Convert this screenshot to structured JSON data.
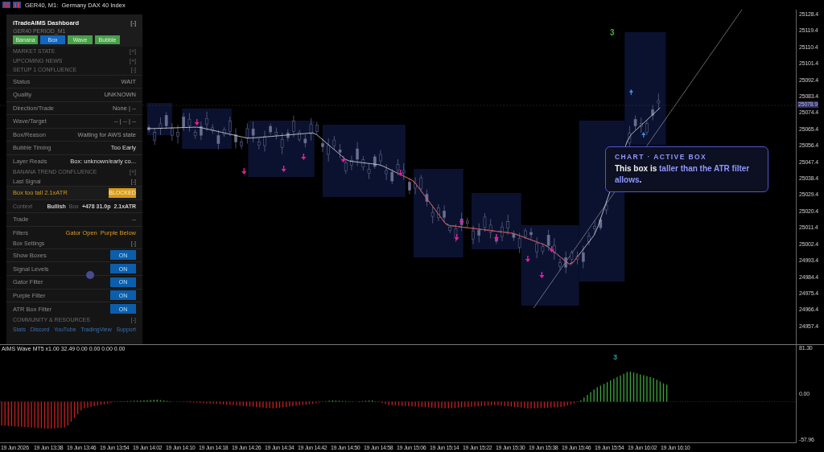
{
  "title_bar": {
    "text": "GER40, M1:  Germany DAX 40 Index"
  },
  "dashboard": {
    "title": "iTradeAIMS Dashboard",
    "collapse": "[-]",
    "subtitle": "GER40 PERIOD_M1",
    "mode_buttons": [
      {
        "label": "Banana",
        "selected": false
      },
      {
        "label": "Box",
        "selected": true
      },
      {
        "label": "Wave",
        "selected": false
      },
      {
        "label": "Bubble",
        "selected": false
      }
    ],
    "items": [
      {
        "kind": "section",
        "title": "MARKET STATE",
        "toggle": "[+]"
      },
      {
        "kind": "section",
        "title": "UPCOMING NEWS",
        "toggle": "[+]"
      },
      {
        "kind": "section",
        "title": "SETUP 1 CONFLUENCE",
        "toggle": "[-]"
      },
      {
        "kind": "row",
        "label": "Status",
        "value": "WAIT",
        "bright": false
      },
      {
        "kind": "row",
        "label": "Quality",
        "value": "UNKNOWN",
        "bright": false
      },
      {
        "kind": "row",
        "label": "Direction/Trade",
        "value": "None | --",
        "bright": false
      },
      {
        "kind": "row",
        "label": "Wave/Target",
        "value": "-- | -- | --",
        "bright": false
      },
      {
        "kind": "row",
        "label": "Box/Reason",
        "value": "Waiting for AWS state",
        "bright": false
      },
      {
        "kind": "row",
        "label": "Bubble Timing",
        "value": "Too Early",
        "bright": true
      },
      {
        "kind": "row",
        "label": "Layer Reads",
        "value": "Box: unknown/early co...",
        "bright": true
      },
      {
        "kind": "section",
        "title": "BANANA TREND CONFLUENCE",
        "toggle": "[+]"
      },
      {
        "kind": "subsection",
        "title": "Last Signal",
        "toggle": "[-]"
      },
      {
        "kind": "alert",
        "text": "Box too tall 2.1xATR",
        "button": "BLOCKED"
      },
      {
        "kind": "context",
        "label": "Context",
        "bias": "Bullish",
        "box": "Box",
        "size": "+478 31.0p",
        "atr": "2.1xATR"
      },
      {
        "kind": "row",
        "label": "Trade",
        "value": "--",
        "bright": false
      },
      {
        "kind": "filters",
        "label": "Filters",
        "values": [
          "Gator Open",
          "Purple Below"
        ]
      },
      {
        "kind": "subsection",
        "title": "Box Settings",
        "toggle": "[-]"
      },
      {
        "kind": "switch",
        "label": "Show Boxes",
        "state": "ON",
        "on": true
      },
      {
        "kind": "switch",
        "label": "Signal Levels",
        "state": "ON",
        "on": true
      },
      {
        "kind": "switch",
        "label": "Gator Filter",
        "state": "ON",
        "on": true
      },
      {
        "kind": "switch",
        "label": "Purple Filter",
        "state": "ON",
        "on": true
      },
      {
        "kind": "switch",
        "label": "ATR Box Filter",
        "state": "ON",
        "on": true
      },
      {
        "kind": "section",
        "title": "COMMUNITY & RESOURCES",
        "toggle": "[-]"
      },
      {
        "kind": "links",
        "links": [
          "Stats",
          "Discord",
          "YouTube",
          "TradingView",
          "Support"
        ]
      }
    ]
  },
  "chart": {
    "wave_label": "3",
    "price_axis": [
      "25128.4",
      "25119.4",
      "25110.4",
      "25101.4",
      "25092.4",
      "25083.4",
      "25074.4",
      "25065.4",
      "25056.4",
      "25047.4",
      "25038.4",
      "25029.4",
      "25020.4",
      "25011.4",
      "25002.4",
      "24993.4",
      "24984.4",
      "24975.4",
      "24966.4",
      "24957.4"
    ],
    "current_price": "25078.9"
  },
  "callout": {
    "title": "CHART · ACTIVE BOX",
    "body": "This box is **taller than the ATR filter allows**."
  },
  "indicator": {
    "label": "AIMS Wave MT5 x1.00 32.49 0.00 0.00 0.00 0.00",
    "wave_label": "3",
    "axis": [
      "81.30",
      "0.00",
      "-57.96"
    ]
  },
  "time_axis": [
    "19 Jun 2026",
    "19 Jun 13:38",
    "19 Jun 13:46",
    "19 Jun 13:54",
    "19 Jun 14:02",
    "19 Jun 14:10",
    "19 Jun 14:18",
    "19 Jun 14:26",
    "19 Jun 14:34",
    "19 Jun 14:42",
    "19 Jun 14:50",
    "19 Jun 14:58",
    "19 Jun 15:06",
    "19 Jun 15:14",
    "19 Jun 15:22",
    "19 Jun 15:30",
    "19 Jun 15:38",
    "19 Jun 15:46",
    "19 Jun 15:54",
    "19 Jun 16:02",
    "19 Jun 16:10"
  ]
}
